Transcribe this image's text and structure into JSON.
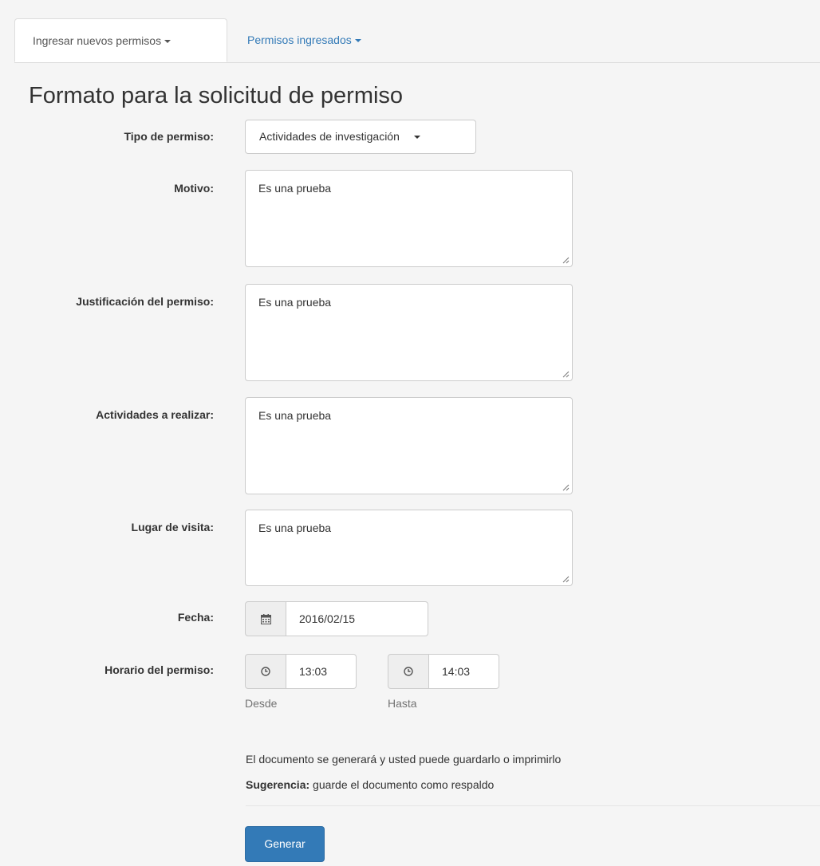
{
  "tabs": [
    {
      "label": "Ingresar nuevos permisos"
    },
    {
      "label": "Permisos ingresados"
    }
  ],
  "form": {
    "title": "Formato para la solicitud de permiso",
    "tipo": {
      "label": "Tipo de permiso:",
      "value": "Actividades de investigación"
    },
    "motivo": {
      "label": "Motivo:",
      "value": "Es una prueba"
    },
    "justificacion": {
      "label": "Justificación del permiso:",
      "value": "Es una prueba"
    },
    "actividades": {
      "label": "Actividades a realizar:",
      "value": "Es una prueba"
    },
    "lugar": {
      "label": "Lugar de visita:",
      "value": "Es una prueba"
    },
    "fecha": {
      "label": "Fecha:",
      "value": "2016/02/15",
      "icon": "calendar-icon"
    },
    "horario": {
      "label": "Horario del permiso:",
      "desde": {
        "value": "13:03",
        "help": "Desde",
        "icon": "clock-icon"
      },
      "hasta": {
        "value": "14:03",
        "help": "Hasta",
        "icon": "clock-icon"
      }
    }
  },
  "info": {
    "line1": "El documento se generará y usted puede guardarlo o imprimirlo",
    "sugerencia_label": "Sugerencia:",
    "sugerencia_text": " guarde el documento como respaldo"
  },
  "submit_label": "Generar",
  "colors": {
    "primary": "#337ab7",
    "link": "#337ab7",
    "background": "#f5f5f5"
  }
}
